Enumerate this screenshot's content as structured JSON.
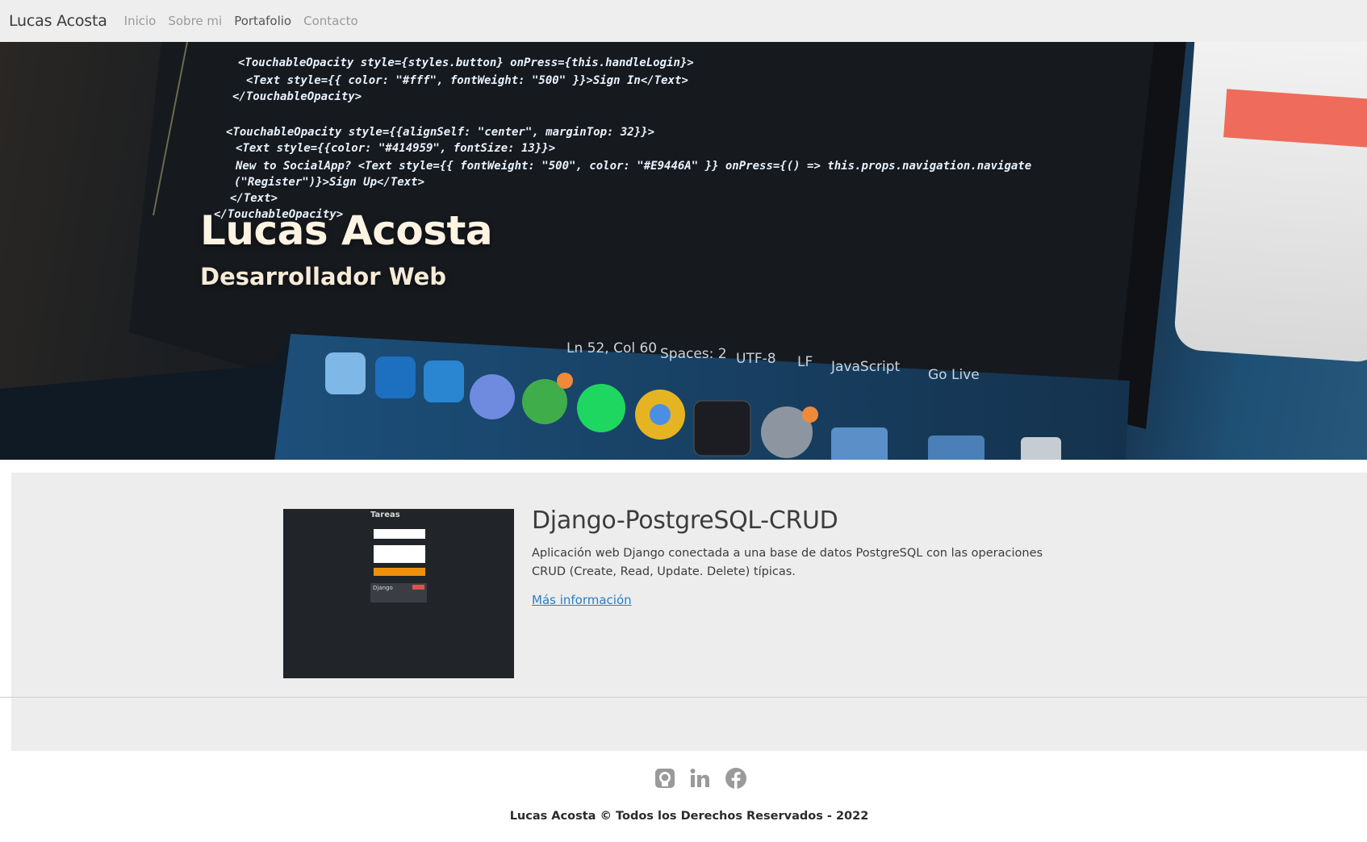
{
  "navbar": {
    "brand": "Lucas Acosta",
    "links": [
      {
        "label": "Inicio"
      },
      {
        "label": "Sobre mi"
      },
      {
        "label": "Portafolio"
      },
      {
        "label": "Contacto"
      }
    ],
    "active_link": "Portafolio"
  },
  "hero": {
    "title": "Lucas Acosta",
    "subtitle": "Desarrollador Web",
    "code_lines": [
      "<TouchableOpacity style={styles.button} onPress={this.handleLogin}>",
      "<Text style={{ color: \"#fff\", fontWeight: \"500\" }}>Sign In</Text>",
      "</TouchableOpacity>",
      "<TouchableOpacity style={{alignSelf: \"center\", marginTop: 32}}>",
      "<Text style={{color: \"#414959\", fontSize: 13}}>",
      "New to SocialApp? <Text style={{ fontWeight: \"500\", color: \"#E9446A\" }} onPress={() => this.props.navigation.navigate",
      "(\"Register\")}>Sign Up</Text>",
      "</Text>",
      "</TouchableOpacity>"
    ],
    "status_bar": [
      "Ln 52, Col 60",
      "Spaces: 2",
      "UTF-8",
      "LF",
      "JavaScript",
      "Go Live"
    ]
  },
  "project": {
    "title": "Django-PostgreSQL-CRUD",
    "description": "Aplicación web Django conectada a una base de datos PostgreSQL con las operaciones CRUD (Create, Read, Update. Delete) típicas.",
    "link_label": "Más información",
    "thumbnail": {
      "title": "Tareas",
      "item_label": "Django"
    }
  },
  "footer": {
    "social_icons": [
      "github-icon",
      "linkedin-icon",
      "facebook-icon"
    ],
    "copyright": "Lucas Acosta © Todos los Derechos Reservados - 2022"
  },
  "colors": {
    "navbar_bg": "#eeeeee",
    "section_bg": "#ededed",
    "link": "#2a7fc1",
    "thumb_bg": "#212529",
    "thumb_button": "#f0900c",
    "icon_gray": "#9a9a9a"
  }
}
